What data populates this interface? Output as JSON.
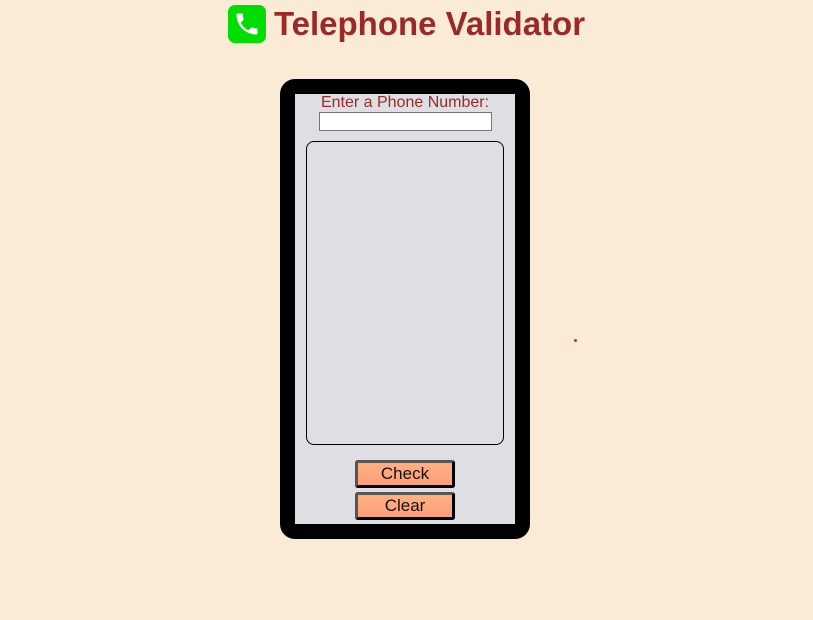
{
  "header": {
    "icon": "phone-icon",
    "icon_color": "#00dd00",
    "title": "Telephone Validator",
    "title_color": "#9a2a2a"
  },
  "form": {
    "label": "Enter a Phone Number:",
    "input_value": "",
    "results_text": "",
    "check_label": "Check",
    "clear_label": "Clear"
  },
  "colors": {
    "background": "#faebd7",
    "screen": "#dfdee3",
    "frame": "#000000",
    "button": "#fe9e7c"
  }
}
